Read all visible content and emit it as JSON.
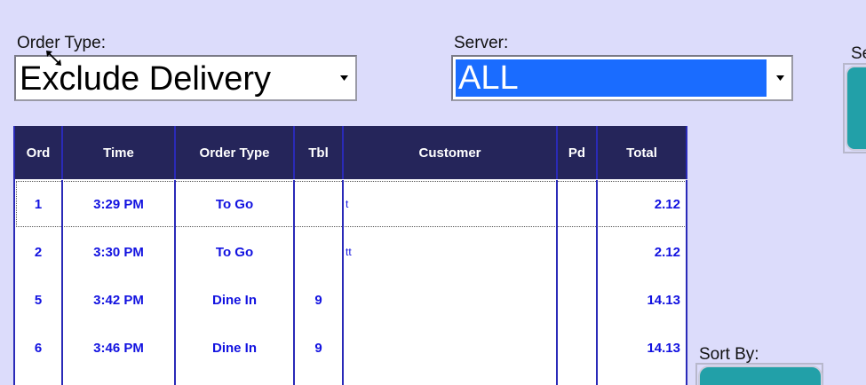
{
  "filters": {
    "order_type_label": "Order Type:",
    "order_type_value": "Exclude Delivery",
    "server_label": "Server:",
    "server_value": "ALL",
    "sort_by_label": "Sort By:",
    "search_label_partial": "Se"
  },
  "grid": {
    "columns": [
      "Ord",
      "Time",
      "Order Type",
      "Tbl",
      "Customer",
      "Pd",
      "Total"
    ],
    "rows": [
      {
        "ord": "1",
        "time": "3:29 PM",
        "order_type": "To Go",
        "tbl": "",
        "customer": "t",
        "pd": "",
        "total": "2.12"
      },
      {
        "ord": "2",
        "time": "3:30 PM",
        "order_type": "To Go",
        "tbl": "",
        "customer": "tt",
        "pd": "",
        "total": "2.12"
      },
      {
        "ord": "5",
        "time": "3:42 PM",
        "order_type": "Dine In",
        "tbl": "9",
        "customer": "",
        "pd": "",
        "total": "14.13"
      },
      {
        "ord": "6",
        "time": "3:46 PM",
        "order_type": "Dine In",
        "tbl": "9",
        "customer": "",
        "pd": "",
        "total": "14.13"
      }
    ]
  },
  "colors": {
    "background": "#dcdcfb",
    "grid_header": "#25255a",
    "grid_text": "#1212e0",
    "selection": "#1a6cff",
    "button_teal": "#22a0a8"
  }
}
